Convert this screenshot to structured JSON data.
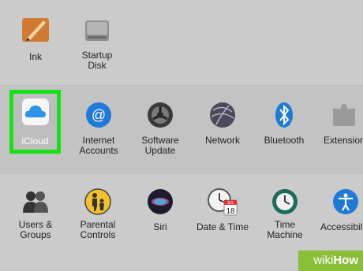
{
  "row1": {
    "ink": "Ink",
    "startup": "Startup\nDisk"
  },
  "row2": {
    "icloud": "iCloud",
    "internet": "Internet\nAccounts",
    "software": "Software\nUpdate",
    "network": "Network",
    "bluetooth": "Bluetooth",
    "extensions": "Extensions"
  },
  "row3": {
    "users": "Users &\nGroups",
    "parental": "Parental\nControls",
    "siri": "Siri",
    "datetime": "Date & Time",
    "timemachine": "Time\nMachine",
    "accessibility": "Accessibility"
  },
  "calendar": {
    "month": "JUL",
    "day": "18"
  },
  "watermark": {
    "prefix": "wiki",
    "suffix": "How"
  },
  "colors": {
    "highlight": "#16e016",
    "accent_blue": "#1e7ad6"
  },
  "icons": [
    "ink-icon",
    "startup-disk-icon",
    "icloud-icon",
    "internet-accounts-icon",
    "software-update-icon",
    "network-icon",
    "bluetooth-icon",
    "extensions-icon",
    "users-groups-icon",
    "parental-controls-icon",
    "siri-icon",
    "date-time-icon",
    "time-machine-icon",
    "accessibility-icon"
  ]
}
